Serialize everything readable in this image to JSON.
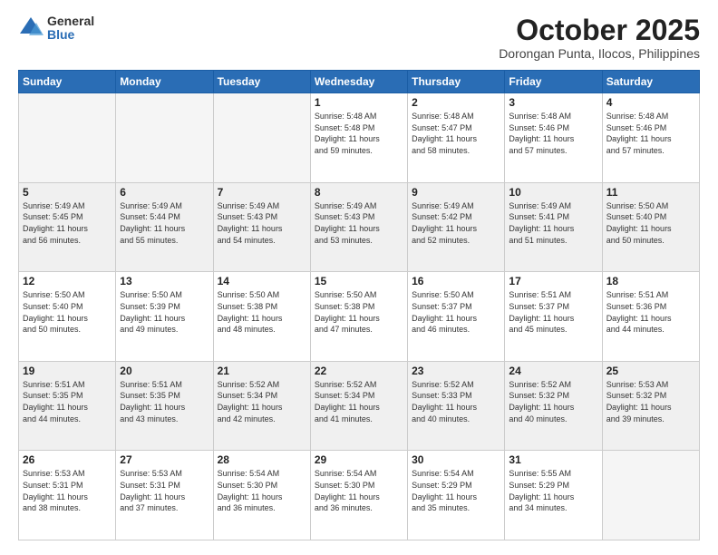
{
  "logo": {
    "general": "General",
    "blue": "Blue"
  },
  "title": "October 2025",
  "location": "Dorongan Punta, Ilocos, Philippines",
  "weekdays": [
    "Sunday",
    "Monday",
    "Tuesday",
    "Wednesday",
    "Thursday",
    "Friday",
    "Saturday"
  ],
  "rows": [
    [
      {
        "day": "",
        "info": ""
      },
      {
        "day": "",
        "info": ""
      },
      {
        "day": "",
        "info": ""
      },
      {
        "day": "1",
        "info": "Sunrise: 5:48 AM\nSunset: 5:48 PM\nDaylight: 11 hours\nand 59 minutes."
      },
      {
        "day": "2",
        "info": "Sunrise: 5:48 AM\nSunset: 5:47 PM\nDaylight: 11 hours\nand 58 minutes."
      },
      {
        "day": "3",
        "info": "Sunrise: 5:48 AM\nSunset: 5:46 PM\nDaylight: 11 hours\nand 57 minutes."
      },
      {
        "day": "4",
        "info": "Sunrise: 5:48 AM\nSunset: 5:46 PM\nDaylight: 11 hours\nand 57 minutes."
      }
    ],
    [
      {
        "day": "5",
        "info": "Sunrise: 5:49 AM\nSunset: 5:45 PM\nDaylight: 11 hours\nand 56 minutes."
      },
      {
        "day": "6",
        "info": "Sunrise: 5:49 AM\nSunset: 5:44 PM\nDaylight: 11 hours\nand 55 minutes."
      },
      {
        "day": "7",
        "info": "Sunrise: 5:49 AM\nSunset: 5:43 PM\nDaylight: 11 hours\nand 54 minutes."
      },
      {
        "day": "8",
        "info": "Sunrise: 5:49 AM\nSunset: 5:43 PM\nDaylight: 11 hours\nand 53 minutes."
      },
      {
        "day": "9",
        "info": "Sunrise: 5:49 AM\nSunset: 5:42 PM\nDaylight: 11 hours\nand 52 minutes."
      },
      {
        "day": "10",
        "info": "Sunrise: 5:49 AM\nSunset: 5:41 PM\nDaylight: 11 hours\nand 51 minutes."
      },
      {
        "day": "11",
        "info": "Sunrise: 5:50 AM\nSunset: 5:40 PM\nDaylight: 11 hours\nand 50 minutes."
      }
    ],
    [
      {
        "day": "12",
        "info": "Sunrise: 5:50 AM\nSunset: 5:40 PM\nDaylight: 11 hours\nand 50 minutes."
      },
      {
        "day": "13",
        "info": "Sunrise: 5:50 AM\nSunset: 5:39 PM\nDaylight: 11 hours\nand 49 minutes."
      },
      {
        "day": "14",
        "info": "Sunrise: 5:50 AM\nSunset: 5:38 PM\nDaylight: 11 hours\nand 48 minutes."
      },
      {
        "day": "15",
        "info": "Sunrise: 5:50 AM\nSunset: 5:38 PM\nDaylight: 11 hours\nand 47 minutes."
      },
      {
        "day": "16",
        "info": "Sunrise: 5:50 AM\nSunset: 5:37 PM\nDaylight: 11 hours\nand 46 minutes."
      },
      {
        "day": "17",
        "info": "Sunrise: 5:51 AM\nSunset: 5:37 PM\nDaylight: 11 hours\nand 45 minutes."
      },
      {
        "day": "18",
        "info": "Sunrise: 5:51 AM\nSunset: 5:36 PM\nDaylight: 11 hours\nand 44 minutes."
      }
    ],
    [
      {
        "day": "19",
        "info": "Sunrise: 5:51 AM\nSunset: 5:35 PM\nDaylight: 11 hours\nand 44 minutes."
      },
      {
        "day": "20",
        "info": "Sunrise: 5:51 AM\nSunset: 5:35 PM\nDaylight: 11 hours\nand 43 minutes."
      },
      {
        "day": "21",
        "info": "Sunrise: 5:52 AM\nSunset: 5:34 PM\nDaylight: 11 hours\nand 42 minutes."
      },
      {
        "day": "22",
        "info": "Sunrise: 5:52 AM\nSunset: 5:34 PM\nDaylight: 11 hours\nand 41 minutes."
      },
      {
        "day": "23",
        "info": "Sunrise: 5:52 AM\nSunset: 5:33 PM\nDaylight: 11 hours\nand 40 minutes."
      },
      {
        "day": "24",
        "info": "Sunrise: 5:52 AM\nSunset: 5:32 PM\nDaylight: 11 hours\nand 40 minutes."
      },
      {
        "day": "25",
        "info": "Sunrise: 5:53 AM\nSunset: 5:32 PM\nDaylight: 11 hours\nand 39 minutes."
      }
    ],
    [
      {
        "day": "26",
        "info": "Sunrise: 5:53 AM\nSunset: 5:31 PM\nDaylight: 11 hours\nand 38 minutes."
      },
      {
        "day": "27",
        "info": "Sunrise: 5:53 AM\nSunset: 5:31 PM\nDaylight: 11 hours\nand 37 minutes."
      },
      {
        "day": "28",
        "info": "Sunrise: 5:54 AM\nSunset: 5:30 PM\nDaylight: 11 hours\nand 36 minutes."
      },
      {
        "day": "29",
        "info": "Sunrise: 5:54 AM\nSunset: 5:30 PM\nDaylight: 11 hours\nand 36 minutes."
      },
      {
        "day": "30",
        "info": "Sunrise: 5:54 AM\nSunset: 5:29 PM\nDaylight: 11 hours\nand 35 minutes."
      },
      {
        "day": "31",
        "info": "Sunrise: 5:55 AM\nSunset: 5:29 PM\nDaylight: 11 hours\nand 34 minutes."
      },
      {
        "day": "",
        "info": ""
      }
    ]
  ],
  "shaded_rows": [
    1,
    3
  ],
  "colors": {
    "header_bg": "#2a6db5",
    "shaded_row": "#f0f0f0",
    "empty_cell": "#f5f5f5"
  }
}
